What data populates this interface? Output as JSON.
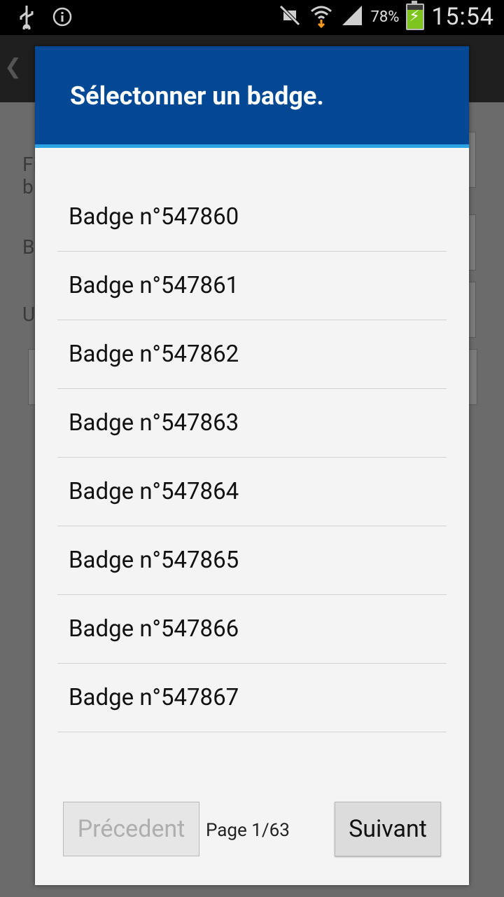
{
  "status_bar": {
    "time": "15:54",
    "battery_percent": "78%",
    "icons": [
      "usb-icon",
      "info-icon",
      "mute-icon",
      "wifi-icon",
      "signal-icon",
      "battery-charging-icon"
    ]
  },
  "background": {
    "partial_labels": [
      "Fi",
      "b",
      "B",
      "U"
    ]
  },
  "dialog": {
    "title": "Sélectonner un badge.",
    "items": [
      "Badge n°547860",
      "Badge n°547861",
      "Badge n°547862",
      "Badge n°547863",
      "Badge n°547864",
      "Badge n°547865",
      "Badge n°547866",
      "Badge n°547867"
    ],
    "pager": {
      "prev_label": "Précedent",
      "page_label": "Page 1/63",
      "next_label": "Suivant"
    }
  },
  "colors": {
    "header_bg": "#024894",
    "header_accent": "#2aa3e3",
    "dialog_bg": "#f4f4f4",
    "battery_fill": "#7ec51f"
  }
}
